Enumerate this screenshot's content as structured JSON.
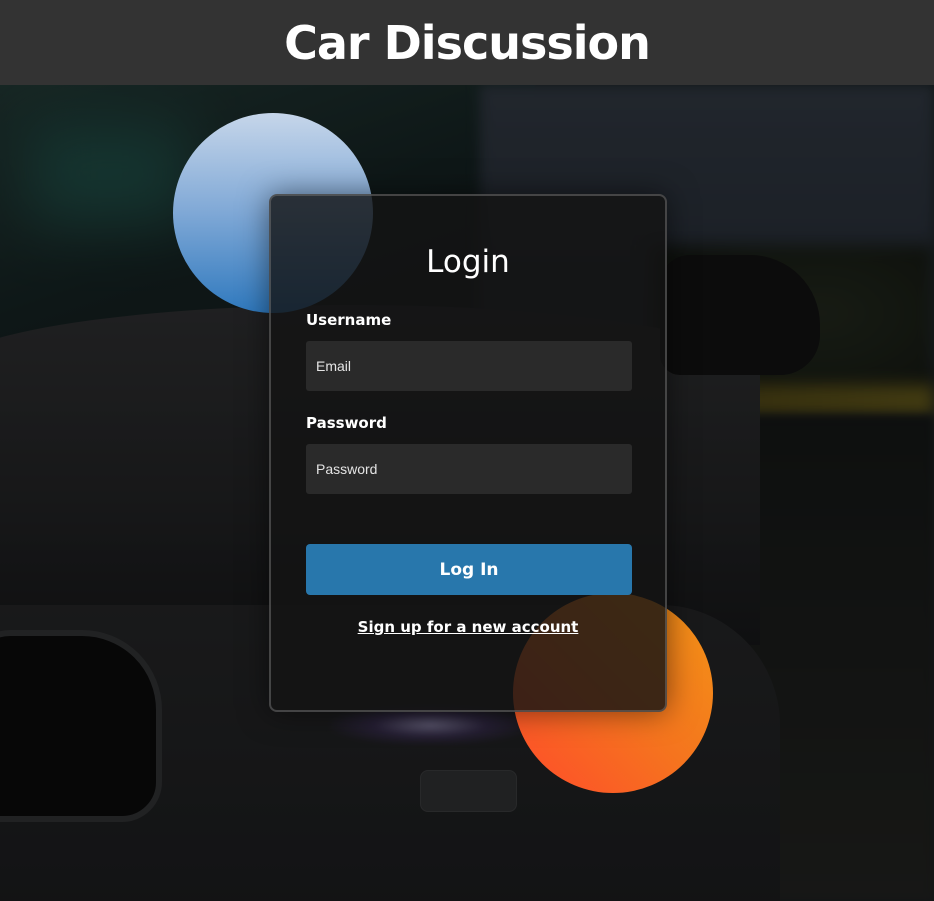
{
  "header": {
    "title": "Car Discussion"
  },
  "login": {
    "title": "Login",
    "username_label": "Username",
    "username_placeholder": "Email",
    "password_label": "Password",
    "password_placeholder": "Password",
    "submit_label": "Log In",
    "signup_link": "Sign up for a new account"
  },
  "colors": {
    "header_bg": "#333333",
    "button": "#2877ac",
    "circle_blue": "#2f79be",
    "circle_orange": "#f5741e"
  }
}
